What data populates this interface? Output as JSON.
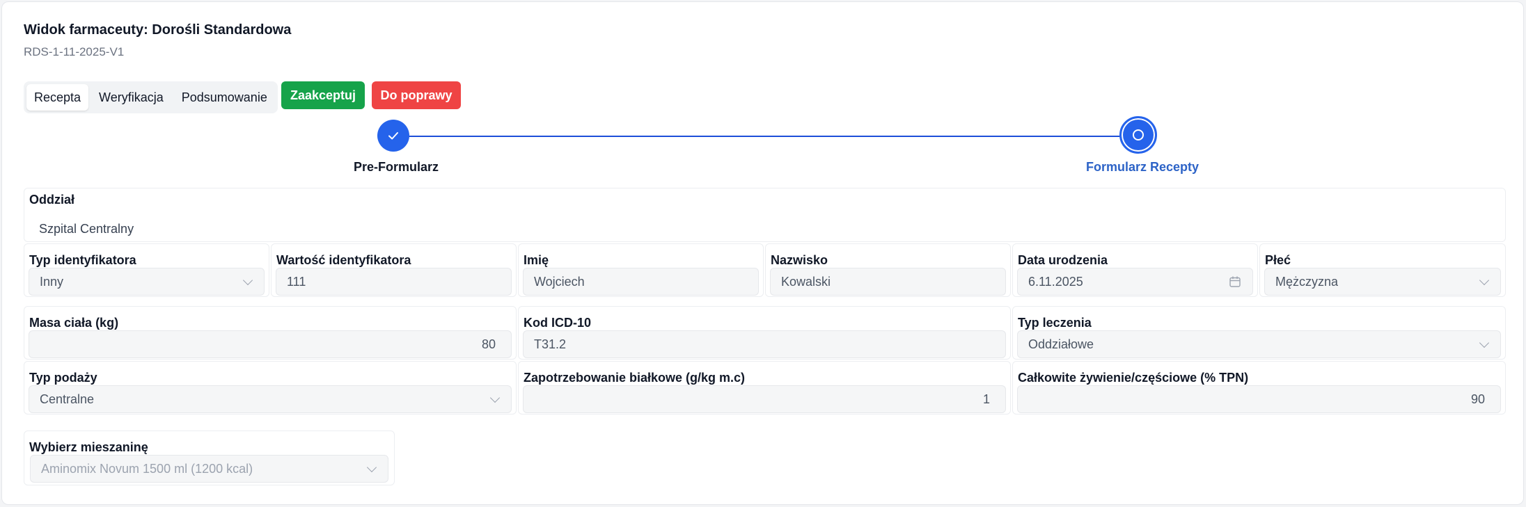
{
  "header": {
    "title": "Widok farmaceuty: Dorośli Standardowa",
    "subtitle": "RDS-1-11-2025-V1"
  },
  "tabs": [
    {
      "label": "Recepta",
      "active": true
    },
    {
      "label": "Weryfikacja",
      "active": false
    },
    {
      "label": "Podsumowanie",
      "active": false
    }
  ],
  "actions": {
    "accept_label": "Zaakceptuj",
    "fix_label": "Do poprawy",
    "accept_color": "#16a34a",
    "fix_color": "#ef4444"
  },
  "stepper": {
    "steps": [
      {
        "label": "Pre-Formularz",
        "status": "completed"
      },
      {
        "label": "Formularz Recepty",
        "status": "current"
      }
    ],
    "accent": "#2563eb"
  },
  "form": {
    "department": {
      "label": "Oddział",
      "value": "Szpital Centralny"
    },
    "id_type": {
      "label": "Typ identyfikatora",
      "value": "Inny"
    },
    "id_value": {
      "label": "Wartość identyfikatora",
      "value": "111"
    },
    "first_name": {
      "label": "Imię",
      "value": "Wojciech"
    },
    "last_name": {
      "label": "Nazwisko",
      "value": "Kowalski"
    },
    "birth_date": {
      "label": "Data urodzenia",
      "value": "6.11.2025"
    },
    "sex": {
      "label": "Płeć",
      "value": "Mężczyzna"
    },
    "weight": {
      "label": "Masa ciała (kg)",
      "value": "80"
    },
    "icd": {
      "label": "Kod ICD-10",
      "value": "T31.2"
    },
    "treatment_type": {
      "label": "Typ leczenia",
      "value": "Oddziałowe"
    },
    "supply_type": {
      "label": "Typ podaży",
      "value": "Centralne"
    },
    "protein": {
      "label": "Zapotrzebowanie białkowe (g/kg m.c)",
      "value": "1"
    },
    "tpn": {
      "label": "Całkowite żywienie/częściowe (% TPN)",
      "value": "90"
    },
    "mixture": {
      "label": "Wybierz mieszaninę",
      "value": "Aminomix Novum 1500 ml (1200 kcal)"
    }
  },
  "icons": {
    "check": "check-icon",
    "chevron": "chevron-down-icon",
    "calendar": "calendar-icon"
  }
}
